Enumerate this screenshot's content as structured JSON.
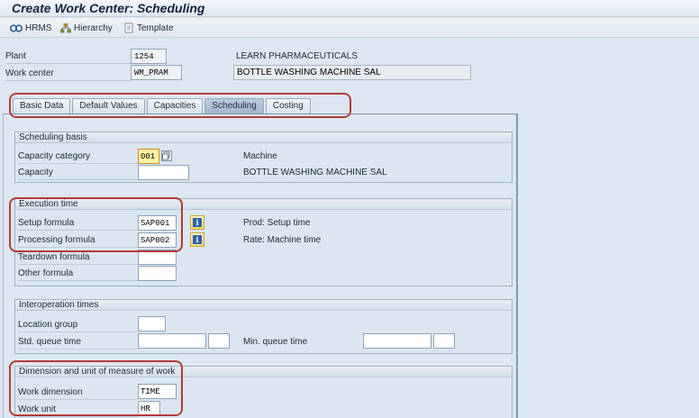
{
  "window": {
    "title": "Create Work Center: Scheduling"
  },
  "toolbar": {
    "hrms_label": "HRMS",
    "hierarchy_label": "Hierarchy",
    "template_label": "Template"
  },
  "header": {
    "plant_label": "Plant",
    "plant_value": "1254",
    "plant_desc": "LEARN PHARMACEUTICALS",
    "work_center_label": "Work center",
    "work_center_value": "WM_PRAM",
    "work_center_desc": "BOTTLE WASHING MACHINE SAL"
  },
  "tabs": [
    {
      "label": "Basic Data"
    },
    {
      "label": "Default Values"
    },
    {
      "label": "Capacities"
    },
    {
      "label": "Scheduling",
      "active": true
    },
    {
      "label": "Costing"
    }
  ],
  "scheduling_basis": {
    "title": "Scheduling basis",
    "capacity_category_label": "Capacity category",
    "capacity_category_value": "001",
    "capacity_category_desc": "Machine",
    "capacity_label": "Capacity",
    "capacity_value": "",
    "capacity_desc": "BOTTLE WASHING MACHINE SAL"
  },
  "execution_time": {
    "title": "Execution time",
    "setup_label": "Setup formula",
    "setup_value": "SAP001",
    "setup_desc": "Prod: Setup time",
    "processing_label": "Processing formula",
    "processing_value": "SAP002",
    "processing_desc": "Rate: Machine time",
    "teardown_label": "Teardown formula",
    "teardown_value": "",
    "other_label": "Other formula",
    "other_value": ""
  },
  "interoperation": {
    "title": "Interoperation times",
    "location_group_label": "Location group",
    "location_group_value": "",
    "std_queue_label": "Std. queue time",
    "std_queue_value": "",
    "std_queue_unit": "",
    "min_queue_label": "Min. queue time",
    "min_queue_value": "",
    "min_queue_unit": ""
  },
  "dimension": {
    "title": "Dimension and unit of measure of work",
    "work_dimension_label": "Work dimension",
    "work_dimension_value": "TIME",
    "work_unit_label": "Work unit",
    "work_unit_value": "HR"
  },
  "colors": {
    "annotation_red": "#b43a3a",
    "required_field": "#fff4a8",
    "tab_active": "#a9bed3"
  },
  "icons": [
    "hrms-icon",
    "hierarchy-icon",
    "template-icon",
    "possible-entries-icon",
    "info-icon"
  ]
}
